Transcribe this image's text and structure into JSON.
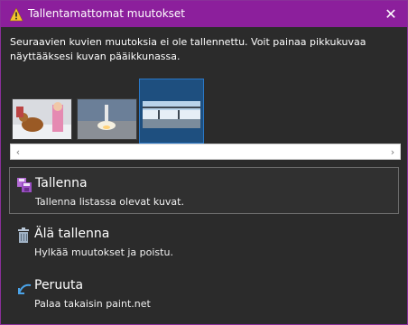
{
  "dialog": {
    "title": "Tallentamattomat muutokset",
    "close_label": "✕",
    "message": "Seuraavien kuvien muutoksia ei ole tallennettu. Voit painaa pikkukuvaa näyttääksesi kuvan pääikkunassa."
  },
  "thumbnails": {
    "items": [
      {
        "name": "dog-and-child-thumbnail",
        "selected": false
      },
      {
        "name": "rocket-launch-thumbnail",
        "selected": false
      },
      {
        "name": "bridge-landscape-thumbnail",
        "selected": true
      }
    ]
  },
  "options": {
    "save": {
      "title": "Tallenna",
      "desc": "Tallenna listassa olevat kuvat."
    },
    "dont_save": {
      "title": "Älä tallenna",
      "desc": "Hylkää muutokset ja poistu."
    },
    "cancel": {
      "title": "Peruuta",
      "desc": "Palaa takaisin paint.net"
    }
  },
  "colors": {
    "titlebar": "#8c1f9c",
    "accent": "#2a78c7",
    "background": "#2b2b2b"
  }
}
